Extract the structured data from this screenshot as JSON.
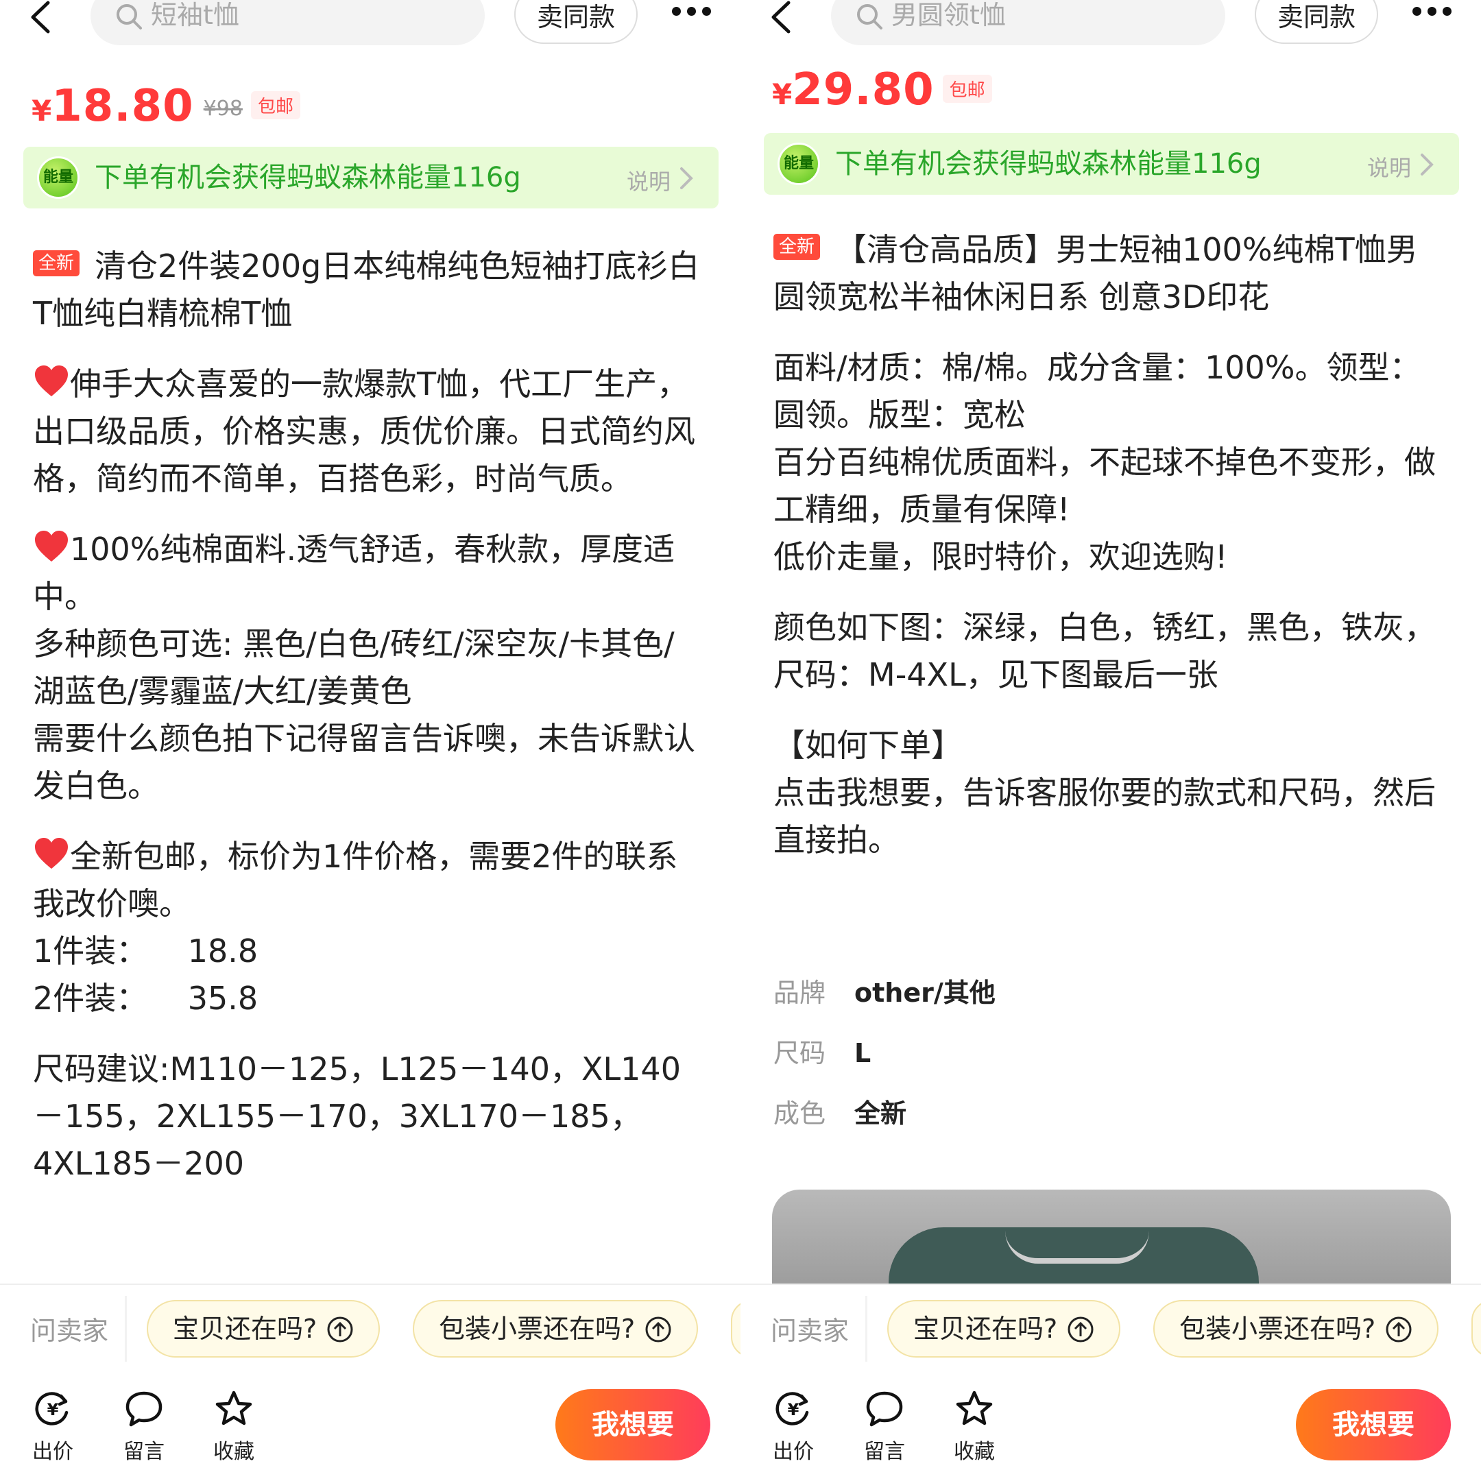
{
  "panels": [
    {
      "search_placeholder": "短袖t恤",
      "same_button": "卖同款",
      "price_currency": "¥",
      "price_value": "18.80",
      "original_price": "¥98",
      "shipping_badge": "包邮",
      "energy_badge": "能量",
      "energy_text": "下单有机会获得蚂蚁森林能量116g",
      "energy_explain": "说明",
      "new_tag": "全新",
      "title": "清仓2件装200g日本纯棉纯色短袖打底衫白T恤纯白精梳棉T恤",
      "desc_1": "伸手大众喜爱的一款爆款T恤，代工厂生产，出口级品质，价格实惠，质优价廉。日式简约风格，简约而不简单，百搭色彩，时尚气质。",
      "desc_2a": "100%纯棉面料.透气舒适，春秋款，厚度适中。",
      "desc_2b": "多种颜色可选: 黑色/白色/砖红/深空灰/卡其色/湖蓝色/雾霾蓝/大红/姜黄色",
      "desc_2c": "需要什么颜色拍下记得留言告诉噢，未告诉默认发白色。",
      "desc_3a": "全新包邮，标价为1件价格，需要2件的联系我改价噢。",
      "desc_3b": "1件装：    18.8",
      "desc_3c": "2件装：    35.8",
      "desc_4": "尺码建议:M110－125，L125－140，XL140－155，2XL155－170，3XL170－185，4XL185－200",
      "ask_label": "问卖家",
      "chip_1": "宝贝还在吗?",
      "chip_2": "包装小票还在吗?",
      "bottom_offer": "出价",
      "bottom_comment": "留言",
      "bottom_fav": "收藏",
      "want_button": "我想要"
    },
    {
      "search_placeholder": "男圆领t恤",
      "same_button": "卖同款",
      "price_currency": "¥",
      "price_value": "29.80",
      "shipping_badge": "包邮",
      "energy_badge": "能量",
      "energy_text": "下单有机会获得蚂蚁森林能量116g",
      "energy_explain": "说明",
      "new_tag": "全新",
      "title": "【清仓高品质】男士短袖100%纯棉T恤男圆领宽松半袖休闲日系 创意3D印花",
      "desc_1a": "面料/材质：棉/棉。成分含量：100%。领型：圆领。版型：宽松",
      "desc_1b": "百分百纯棉优质面料，不起球不掉色不变形，做工精细，质量有保障!",
      "desc_1c": "低价走量，限时特价，欢迎选购!",
      "desc_2a": "颜色如下图：深绿，白色，锈红，黑色，铁灰，",
      "desc_2b": "尺码：M-4XL，见下图最后一张",
      "desc_3a": "【如何下单】",
      "desc_3b": "点击我想要，告诉客服你要的款式和尺码，然后直接拍。",
      "spec_brand_label": "品牌",
      "spec_brand_value": "other/其他",
      "spec_size_label": "尺码",
      "spec_size_value": "L",
      "spec_cond_label": "成色",
      "spec_cond_value": "全新",
      "ask_label": "问卖家",
      "chip_1": "宝贝还在吗?",
      "chip_2": "包装小票还在吗?",
      "bottom_offer": "出价",
      "bottom_comment": "留言",
      "bottom_fav": "收藏",
      "want_button": "我想要"
    }
  ],
  "colors": {
    "price_red": "#ff3a3a",
    "energy_green": "#2aa62a",
    "energy_bg": "#e8fbd6",
    "want_gradient_start": "#ff7a1a",
    "want_gradient_end": "#ff3d5a",
    "chip_bg": "#fffbe8"
  },
  "icons": {
    "back": "chevron-left-icon",
    "search": "search-icon",
    "more": "more-dots-icon",
    "heart": "heart-icon",
    "offer": "yuan-cycle-icon",
    "comment": "chat-bubble-icon",
    "favorite": "star-icon",
    "chip_arrow": "arrow-up-circle-icon"
  }
}
